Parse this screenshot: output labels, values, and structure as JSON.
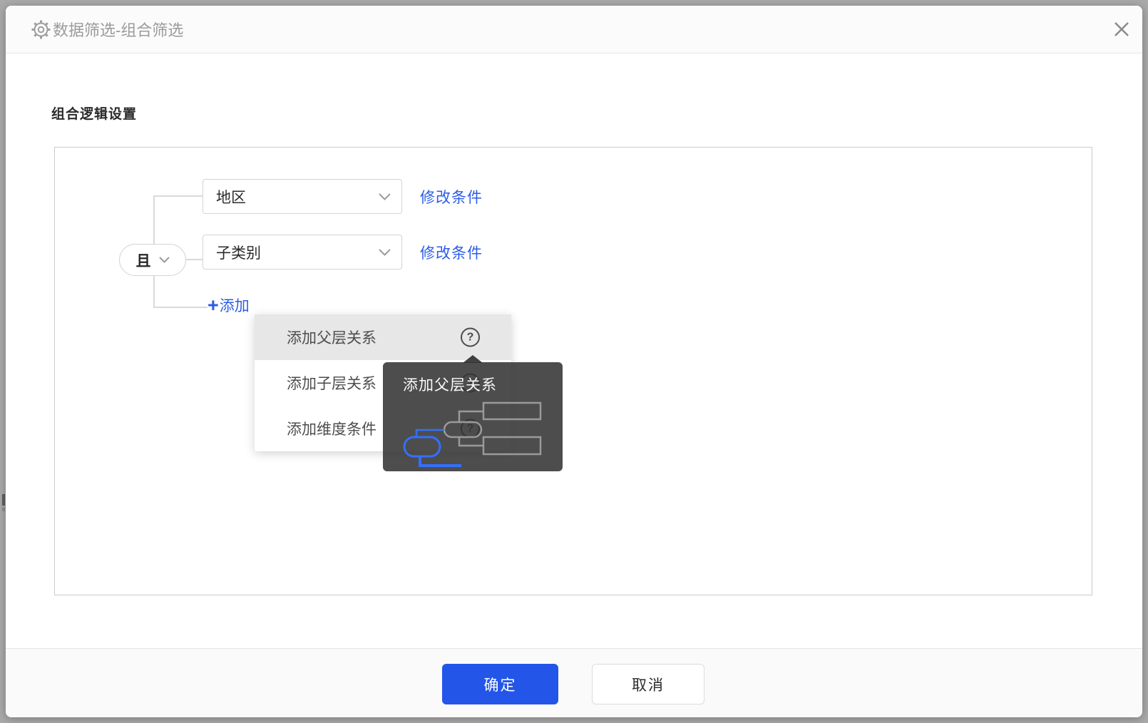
{
  "dialog": {
    "title": "数据筛选-组合筛选"
  },
  "content": {
    "section_heading": "组合逻辑设置"
  },
  "filter_tree": {
    "operator": "且",
    "rows": [
      {
        "field": "地区",
        "action_label": "修改条件"
      },
      {
        "field": "子类别",
        "action_label": "修改条件"
      }
    ],
    "add_icon_glyph": "+",
    "add_label": "添加"
  },
  "context_menu": {
    "help_glyph": "?",
    "items": [
      {
        "label": "添加父层关系"
      },
      {
        "label": "添加子层关系"
      },
      {
        "label": "添加维度条件"
      }
    ]
  },
  "help_tooltip": {
    "title": "添加父层关系"
  },
  "footer": {
    "confirm_label": "确定",
    "cancel_label": "取消"
  },
  "colors": {
    "accent_blue": "#2355e8",
    "link_blue": "#2b5ce8",
    "menu_highlight_bg": "#e7e7e7",
    "tooltip_bg": "rgba(50,50,50,0.87)",
    "illustration_blue": "#3370ff"
  }
}
